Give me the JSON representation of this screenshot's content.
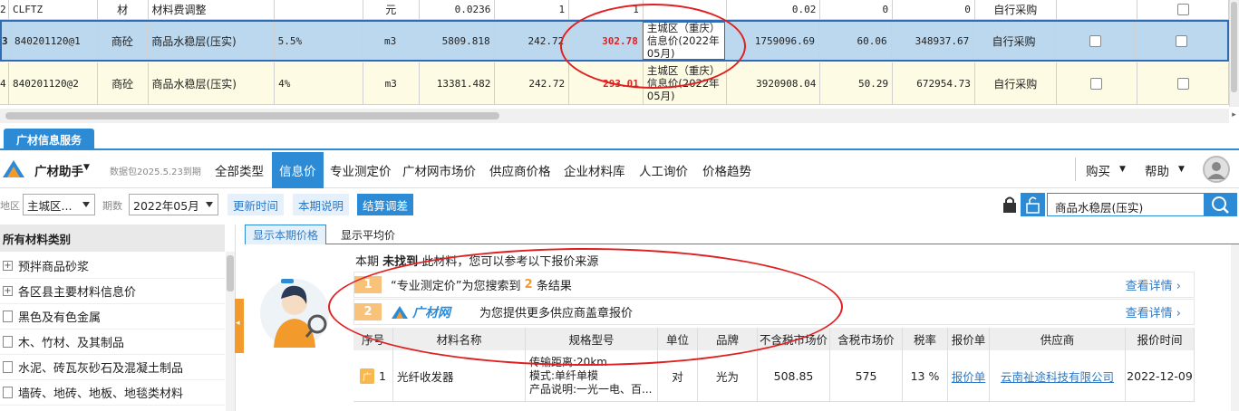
{
  "grid": {
    "rows": [
      {
        "idx": "2",
        "code": "CLFTZ",
        "type": "材",
        "name": "材料费调整",
        "spec": "",
        "unit": "元",
        "qty": "0.0236",
        "price": "1",
        "market": "1",
        "info": "",
        "total": "0.02",
        "c1": "0",
        "c2": "0",
        "supply": "自行采购"
      },
      {
        "idx": "3",
        "code": "840201120@1",
        "type": "商砼",
        "name": "商品水稳层(压实)",
        "spec": "5.5%",
        "unit": "m3",
        "qty": "5809.818",
        "price": "242.72",
        "market": "302.78",
        "info": "主城区（重庆）信息价(2022年05月)",
        "total": "1759096.69",
        "c1": "60.06",
        "c2": "348937.67",
        "supply": "自行采购"
      },
      {
        "idx": "4",
        "code": "840201120@2",
        "type": "商砼",
        "name": "商品水稳层(压实)",
        "spec": "4%",
        "unit": "m3",
        "qty": "13381.482",
        "price": "242.72",
        "market": "293.01",
        "info": "主城区（重庆）信息价(2022年05月)",
        "total": "3920908.04",
        "c1": "50.29",
        "c2": "672954.73",
        "supply": "自行采购"
      }
    ]
  },
  "panel": {
    "tab": "广材信息服务",
    "app_name": "广材助手",
    "data_pack": "数据包2025.5.23到期",
    "nav": [
      "全部类型",
      "信息价",
      "专业测定价",
      "广材网市场价",
      "供应商价格",
      "企业材料库",
      "人工询价",
      "价格趋势"
    ],
    "buy": "购买",
    "help": "帮助",
    "region_label": "地区",
    "region_value": "主城区...",
    "period_label": "期数",
    "period_value": "2022年05月",
    "btn_update": "更新时间",
    "btn_note": "本期说明",
    "btn_settle": "结算调差",
    "search_value": "商品水稳层(压实)"
  },
  "sidebar": {
    "head": "所有材料类别",
    "items": [
      {
        "label": "预拌商品砂浆",
        "icon": "plus"
      },
      {
        "label": "各区县主要材料信息价",
        "icon": "plus"
      },
      {
        "label": "黑色及有色金属",
        "icon": "doc"
      },
      {
        "label": "木、竹材、及其制品",
        "icon": "doc"
      },
      {
        "label": "水泥、砖瓦灰砂石及混凝土制品",
        "icon": "doc"
      },
      {
        "label": "墙砖、地砖、地板、地毯类材料",
        "icon": "doc"
      }
    ]
  },
  "main": {
    "subtabs": [
      "显示本期价格",
      "显示平均价"
    ],
    "notfound_pre": "本期",
    "notfound_bold": "未找到",
    "notfound_post": "此材料，您可以参考以下报价来源",
    "src1_num": "1",
    "src1_a": "“专业测定价”为您搜索到",
    "src1_count": "2",
    "src1_b": "条结果",
    "src2_num": "2",
    "src2_logo": "广材网",
    "src2_text": "为您提供更多供应商盖章报价",
    "more": "查看详情",
    "table_headers": [
      "序号",
      "材料名称",
      "规格型号",
      "单位",
      "品牌",
      "不含税市场价",
      "含税市场价",
      "税率",
      "报价单",
      "供应商",
      "报价时间"
    ],
    "row": {
      "idx": "1",
      "name": "光纤收发器",
      "spec1": "传输距离:20km",
      "spec2": "模式:单纤单模",
      "spec3": "产品说明:一光一电、百...",
      "unit": "对",
      "brand": "光为",
      "price_ex": "508.85",
      "price_in": "575",
      "tax": "13 %",
      "quote": "报价单",
      "supplier": "云南祉途科技有限公司",
      "date": "2022-12-09"
    }
  },
  "colors": {
    "accent": "#2d8bd6",
    "annotation": "#e02020",
    "orange": "#f39a2c"
  }
}
